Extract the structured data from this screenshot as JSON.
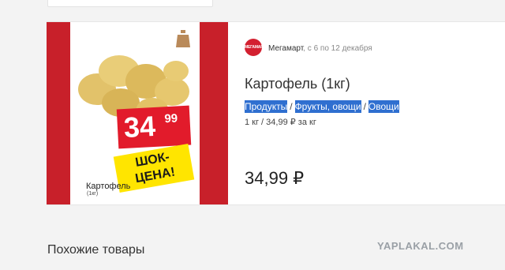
{
  "product": {
    "title": "Картофель (1кг)",
    "unit_price": "1 кг / 34,99 ₽ за кг",
    "price": "34,99 ₽",
    "categories": [
      {
        "label": "Продукты"
      },
      {
        "label": "Фрукты, овощи"
      },
      {
        "label": "Овощи"
      }
    ],
    "separator": "/"
  },
  "store": {
    "name": "Мегамарт",
    "dates": ", с 6 по 12 декабря",
    "logo_text": "МЕГАМАРТ",
    "brand_color": "#d32030"
  },
  "promo": {
    "price_int": "34",
    "price_cents": "99",
    "badge_line1": "ШОК-",
    "badge_line2": "ЦЕНА!",
    "name": "Картофель",
    "weight": "(1кг)",
    "stripe_color": "#c8202a",
    "price_color": "#e21b2b",
    "badge_color": "#ffe500",
    "icons": [
      "weight-icon",
      "potatoes-image"
    ]
  },
  "similar_title": "Похожие товары",
  "watermark": "YAPLAKAL.COM"
}
